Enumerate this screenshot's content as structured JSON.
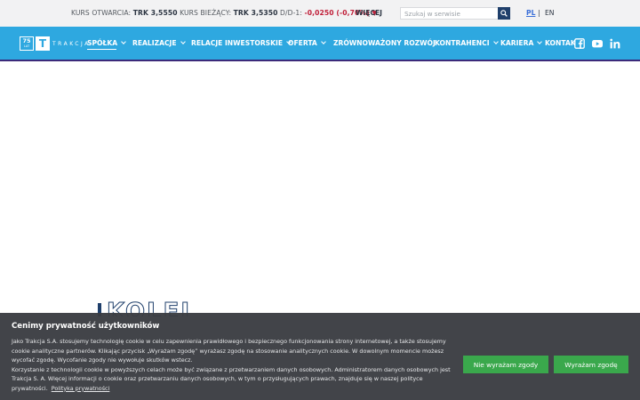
{
  "ticker": {
    "open_label": "KURS OTWARCIA:",
    "open_value": "TRK 3,5550",
    "current_label": "KURS BIEŻĄCY:",
    "current_value": "TRK 3,5350",
    "change_label": "D/D-1:",
    "change_value": "-0,0250 (-0,70%) ▼",
    "more_label": "WIĘCEJ"
  },
  "search": {
    "placeholder": "Szukaj w serwisie"
  },
  "lang": {
    "pl": "PL",
    "separator": "|",
    "en": "EN"
  },
  "logo": {
    "years": "75",
    "years_sub": "LAT",
    "letter": "T",
    "text": "TRAKCJA"
  },
  "nav": {
    "items": [
      {
        "label": "SPÓŁKA"
      },
      {
        "label": "REALIZACJE"
      },
      {
        "label": "RELACJE INWESTORSKIE"
      },
      {
        "label": "OFERTA"
      },
      {
        "label": "ZRÓWNOWAŻONY ROZWÓJ"
      },
      {
        "label": "KONTRAHENCI"
      },
      {
        "label": "KARIERA"
      },
      {
        "label": "KONTAKT"
      }
    ]
  },
  "social": {
    "icons": [
      "facebook-icon",
      "youtube-icon",
      "linkedin-icon"
    ]
  },
  "hero": {
    "word": "KOLEJ"
  },
  "cookie": {
    "title": "Cenimy prywatność użytkowników",
    "p1": "Jako Trakcja S.A. stosujemy technologię cookie w celu zapewnienia prawidłowego i bezpiecznego funkcjonowania strony internetowej, a także stosujemy cookie analityczne partnerów. Klikając przycisk „Wyrażam zgodę” wyrażasz zgodę na stosowanie analitycznych cookie. W dowolnym momencie możesz wycofać zgodę. Wycofanie zgody nie wywołuje skutków wstecz.",
    "p2": "Korzystanie z technologii cookie w powyższych celach może być związane z przetwarzaniem danych osobowych. Administratorem danych osobowych jest Trakcja S. A. Więcej informacji o cookie oraz przetwarzaniu danych osobowych, w tym o przysługujących prawach, znajduje się w naszej polityce prywatności.",
    "link": "Polityka prywatności",
    "deny_label": "Nie wyrażam zgody",
    "accept_label": "Wyrażam zgodę"
  },
  "colors": {
    "topbar_bg": "#f2f2f3",
    "nav_bg": "#2ea8e0",
    "accent_dark": "#1f3f6b",
    "negative": "#c0203a",
    "button_green": "#3aa84c",
    "cookie_bg": "#3a3c42"
  }
}
